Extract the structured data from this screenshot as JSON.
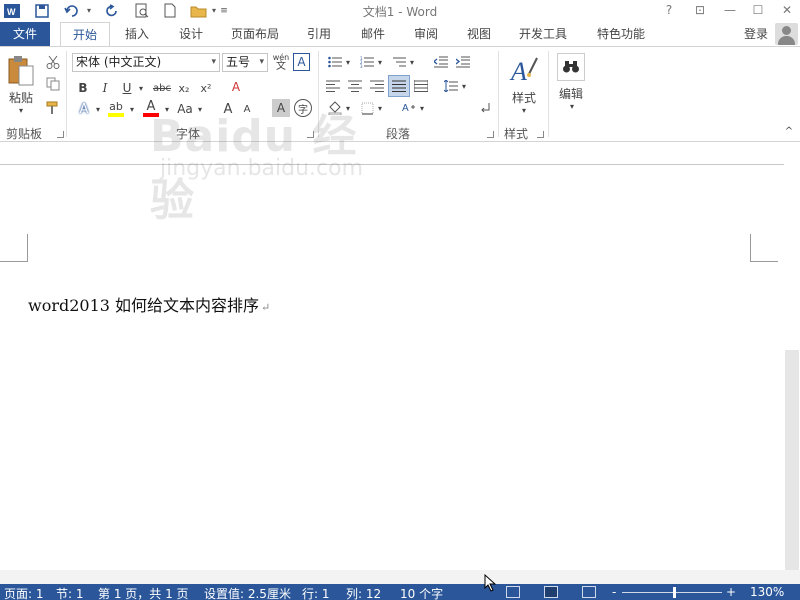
{
  "titlebar": {
    "title": "文档1 - Word",
    "help": "?",
    "min": "—",
    "max": "☐",
    "close": "✕",
    "restore": "⊡"
  },
  "tabs": [
    {
      "label": "文件"
    },
    {
      "label": "开始"
    },
    {
      "label": "插入"
    },
    {
      "label": "设计"
    },
    {
      "label": "页面布局"
    },
    {
      "label": "引用"
    },
    {
      "label": "邮件"
    },
    {
      "label": "审阅"
    },
    {
      "label": "视图"
    },
    {
      "label": "开发工具"
    },
    {
      "label": "特色功能"
    }
  ],
  "account": {
    "login": "登录"
  },
  "ribbon": {
    "clipboard": {
      "paste": "粘贴",
      "group": "剪贴板"
    },
    "font": {
      "font_name": "宋体 (中文正文)",
      "font_size": "五号",
      "wen": "wén",
      "wen_zi": "文",
      "box_a": "A",
      "bold": "B",
      "italic": "I",
      "underline": "U",
      "strike": "abc",
      "sub": "x₂",
      "sup": "x²",
      "effects": "A",
      "highlight": "ab",
      "color": "A",
      "aa": "Aa",
      "grow": "A",
      "shrink": "A",
      "clear": "A",
      "char_shade": "A",
      "enclose": "字",
      "group": "字体"
    },
    "paragraph": {
      "group": "段落"
    },
    "styles": {
      "label": "样式",
      "group": "样式"
    },
    "editing": {
      "label": "编辑"
    }
  },
  "document": {
    "text": "word2013 如何给文本内容排序",
    "para_mark": "↵"
  },
  "status": {
    "page": "页面: 1",
    "section": "节: 1",
    "page_of": "第 1 页，共 1 页",
    "setting": "设置值: 2.5厘米",
    "line": "行: 1",
    "col": "列: 12",
    "words": "10 个字",
    "zoom": "130%",
    "minus": "-",
    "plus": "+"
  },
  "watermark": {
    "logo": "Baidu 经验",
    "url": "jingyan.baidu.com"
  },
  "colors": {
    "brand": "#2b579a",
    "highlight": "#ffff00",
    "font_color": "#ff0000"
  }
}
